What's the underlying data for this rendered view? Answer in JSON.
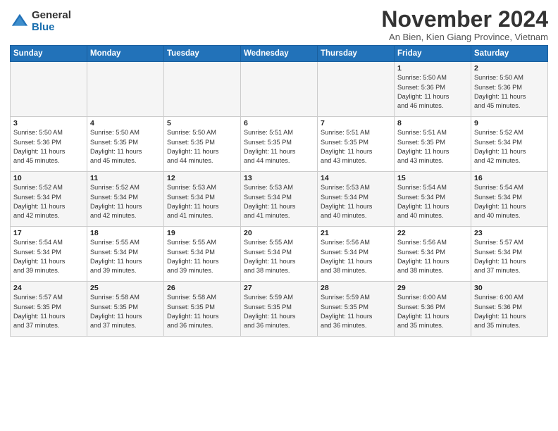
{
  "logo": {
    "general": "General",
    "blue": "Blue"
  },
  "title": "November 2024",
  "location": "An Bien, Kien Giang Province, Vietnam",
  "headers": [
    "Sunday",
    "Monday",
    "Tuesday",
    "Wednesday",
    "Thursday",
    "Friday",
    "Saturday"
  ],
  "weeks": [
    {
      "days": [
        {
          "num": "",
          "info": ""
        },
        {
          "num": "",
          "info": ""
        },
        {
          "num": "",
          "info": ""
        },
        {
          "num": "",
          "info": ""
        },
        {
          "num": "",
          "info": ""
        },
        {
          "num": "1",
          "info": "Sunrise: 5:50 AM\nSunset: 5:36 PM\nDaylight: 11 hours\nand 46 minutes."
        },
        {
          "num": "2",
          "info": "Sunrise: 5:50 AM\nSunset: 5:36 PM\nDaylight: 11 hours\nand 45 minutes."
        }
      ]
    },
    {
      "days": [
        {
          "num": "3",
          "info": "Sunrise: 5:50 AM\nSunset: 5:36 PM\nDaylight: 11 hours\nand 45 minutes."
        },
        {
          "num": "4",
          "info": "Sunrise: 5:50 AM\nSunset: 5:35 PM\nDaylight: 11 hours\nand 45 minutes."
        },
        {
          "num": "5",
          "info": "Sunrise: 5:50 AM\nSunset: 5:35 PM\nDaylight: 11 hours\nand 44 minutes."
        },
        {
          "num": "6",
          "info": "Sunrise: 5:51 AM\nSunset: 5:35 PM\nDaylight: 11 hours\nand 44 minutes."
        },
        {
          "num": "7",
          "info": "Sunrise: 5:51 AM\nSunset: 5:35 PM\nDaylight: 11 hours\nand 43 minutes."
        },
        {
          "num": "8",
          "info": "Sunrise: 5:51 AM\nSunset: 5:35 PM\nDaylight: 11 hours\nand 43 minutes."
        },
        {
          "num": "9",
          "info": "Sunrise: 5:52 AM\nSunset: 5:34 PM\nDaylight: 11 hours\nand 42 minutes."
        }
      ]
    },
    {
      "days": [
        {
          "num": "10",
          "info": "Sunrise: 5:52 AM\nSunset: 5:34 PM\nDaylight: 11 hours\nand 42 minutes."
        },
        {
          "num": "11",
          "info": "Sunrise: 5:52 AM\nSunset: 5:34 PM\nDaylight: 11 hours\nand 42 minutes."
        },
        {
          "num": "12",
          "info": "Sunrise: 5:53 AM\nSunset: 5:34 PM\nDaylight: 11 hours\nand 41 minutes."
        },
        {
          "num": "13",
          "info": "Sunrise: 5:53 AM\nSunset: 5:34 PM\nDaylight: 11 hours\nand 41 minutes."
        },
        {
          "num": "14",
          "info": "Sunrise: 5:53 AM\nSunset: 5:34 PM\nDaylight: 11 hours\nand 40 minutes."
        },
        {
          "num": "15",
          "info": "Sunrise: 5:54 AM\nSunset: 5:34 PM\nDaylight: 11 hours\nand 40 minutes."
        },
        {
          "num": "16",
          "info": "Sunrise: 5:54 AM\nSunset: 5:34 PM\nDaylight: 11 hours\nand 40 minutes."
        }
      ]
    },
    {
      "days": [
        {
          "num": "17",
          "info": "Sunrise: 5:54 AM\nSunset: 5:34 PM\nDaylight: 11 hours\nand 39 minutes."
        },
        {
          "num": "18",
          "info": "Sunrise: 5:55 AM\nSunset: 5:34 PM\nDaylight: 11 hours\nand 39 minutes."
        },
        {
          "num": "19",
          "info": "Sunrise: 5:55 AM\nSunset: 5:34 PM\nDaylight: 11 hours\nand 39 minutes."
        },
        {
          "num": "20",
          "info": "Sunrise: 5:55 AM\nSunset: 5:34 PM\nDaylight: 11 hours\nand 38 minutes."
        },
        {
          "num": "21",
          "info": "Sunrise: 5:56 AM\nSunset: 5:34 PM\nDaylight: 11 hours\nand 38 minutes."
        },
        {
          "num": "22",
          "info": "Sunrise: 5:56 AM\nSunset: 5:34 PM\nDaylight: 11 hours\nand 38 minutes."
        },
        {
          "num": "23",
          "info": "Sunrise: 5:57 AM\nSunset: 5:34 PM\nDaylight: 11 hours\nand 37 minutes."
        }
      ]
    },
    {
      "days": [
        {
          "num": "24",
          "info": "Sunrise: 5:57 AM\nSunset: 5:35 PM\nDaylight: 11 hours\nand 37 minutes."
        },
        {
          "num": "25",
          "info": "Sunrise: 5:58 AM\nSunset: 5:35 PM\nDaylight: 11 hours\nand 37 minutes."
        },
        {
          "num": "26",
          "info": "Sunrise: 5:58 AM\nSunset: 5:35 PM\nDaylight: 11 hours\nand 36 minutes."
        },
        {
          "num": "27",
          "info": "Sunrise: 5:59 AM\nSunset: 5:35 PM\nDaylight: 11 hours\nand 36 minutes."
        },
        {
          "num": "28",
          "info": "Sunrise: 5:59 AM\nSunset: 5:35 PM\nDaylight: 11 hours\nand 36 minutes."
        },
        {
          "num": "29",
          "info": "Sunrise: 6:00 AM\nSunset: 5:36 PM\nDaylight: 11 hours\nand 35 minutes."
        },
        {
          "num": "30",
          "info": "Sunrise: 6:00 AM\nSunset: 5:36 PM\nDaylight: 11 hours\nand 35 minutes."
        }
      ]
    }
  ]
}
